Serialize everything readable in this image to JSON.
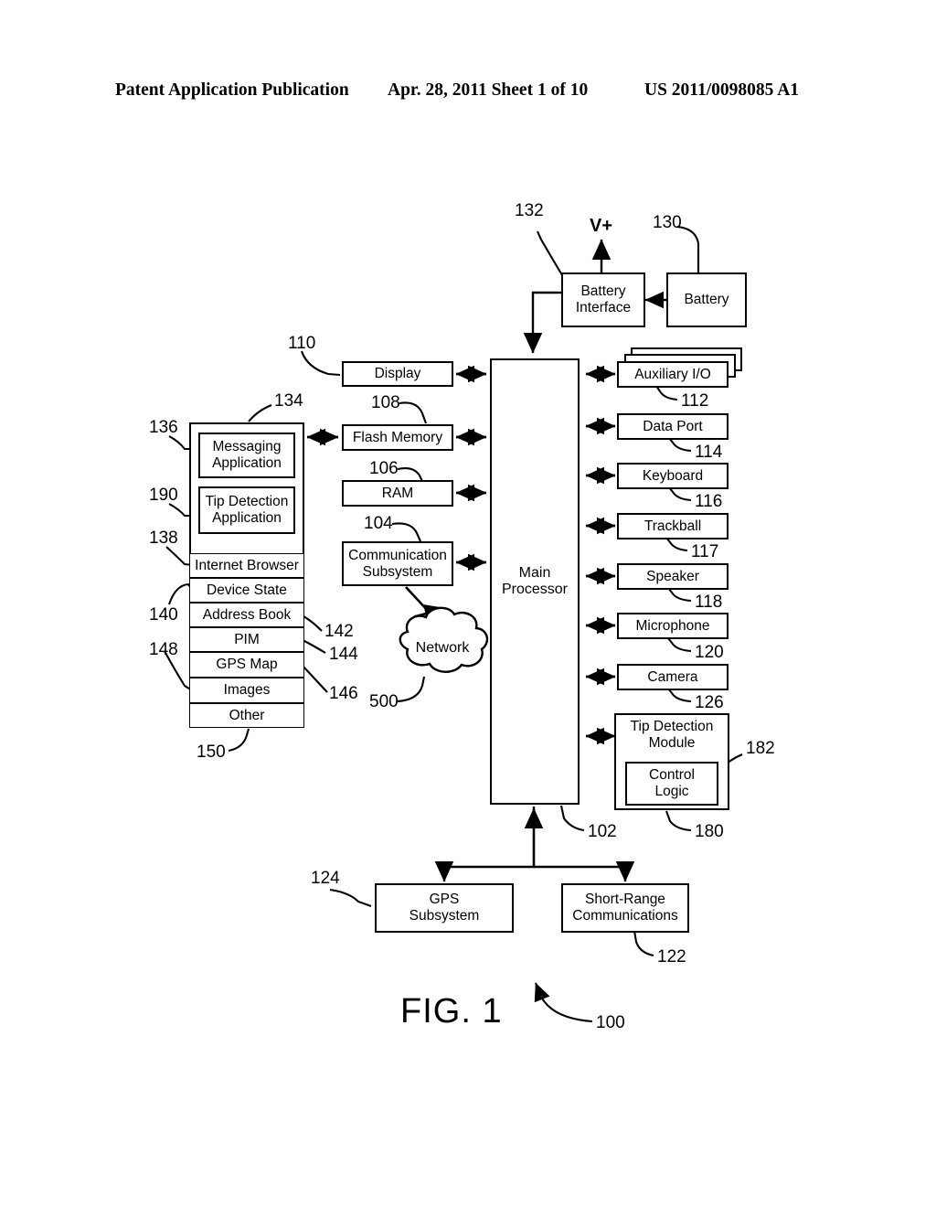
{
  "header": {
    "publication": "Patent Application Publication",
    "date_sheet": "Apr. 28, 2011  Sheet 1 of 10",
    "doc_number": "US 2011/0098085 A1"
  },
  "figure": {
    "label": "FIG. 1",
    "system_ref": "100"
  },
  "power": {
    "vplus": "V+",
    "battery_interface": {
      "label": "Battery\nInterface",
      "line1": "Battery",
      "line2": "Interface",
      "ref": "132"
    },
    "battery": {
      "label": "Battery",
      "ref": "130"
    }
  },
  "memory_column": {
    "display": {
      "label": "Display",
      "ref": "110"
    },
    "flash_memory": {
      "label": "Flash Memory",
      "ref": "108"
    },
    "ram": {
      "label": "RAM",
      "ref": "106"
    },
    "communication_subsystem": {
      "line1": "Communication",
      "line2": "Subsystem",
      "ref": "104"
    }
  },
  "processor": {
    "line1": "Main",
    "line2": "Processor",
    "ref": "102"
  },
  "network": {
    "label": "Network",
    "ref": "500"
  },
  "applications": {
    "container_ref": "134",
    "messaging": {
      "line1": "Messaging",
      "line2": "Application",
      "ref": "136"
    },
    "tip_detection": {
      "line1": "Tip Detection",
      "line2": "Application",
      "ref": "190"
    },
    "rows": [
      {
        "label": "Internet Browser",
        "ref": "138"
      },
      {
        "label": "Device State",
        "ref": "140"
      },
      {
        "label": "Address Book",
        "ref": "142"
      },
      {
        "label": "PIM",
        "ref": "144"
      },
      {
        "label": "GPS Map",
        "ref": "146"
      },
      {
        "label": "Images",
        "ref": "148"
      },
      {
        "label": "Other",
        "ref": "150"
      }
    ]
  },
  "peripherals": [
    {
      "label": "Auxiliary I/O",
      "ref": "112"
    },
    {
      "label": "Data Port",
      "ref": "114"
    },
    {
      "label": "Keyboard",
      "ref": "116"
    },
    {
      "label": "Trackball",
      "ref": "117"
    },
    {
      "label": "Speaker",
      "ref": "118"
    },
    {
      "label": "Microphone",
      "ref": "120"
    },
    {
      "label": "Camera",
      "ref": "126"
    }
  ],
  "tip_detection_module": {
    "line1": "Tip Detection",
    "line2": "Module",
    "ref": "180",
    "control_logic": {
      "line1": "Control",
      "line2": "Logic",
      "ref": "182"
    }
  },
  "bottom_subsystems": {
    "gps": {
      "line1": "GPS",
      "line2": "Subsystem",
      "ref": "124"
    },
    "short_range": {
      "line1": "Short-Range",
      "line2": "Communications",
      "ref": "122"
    }
  }
}
